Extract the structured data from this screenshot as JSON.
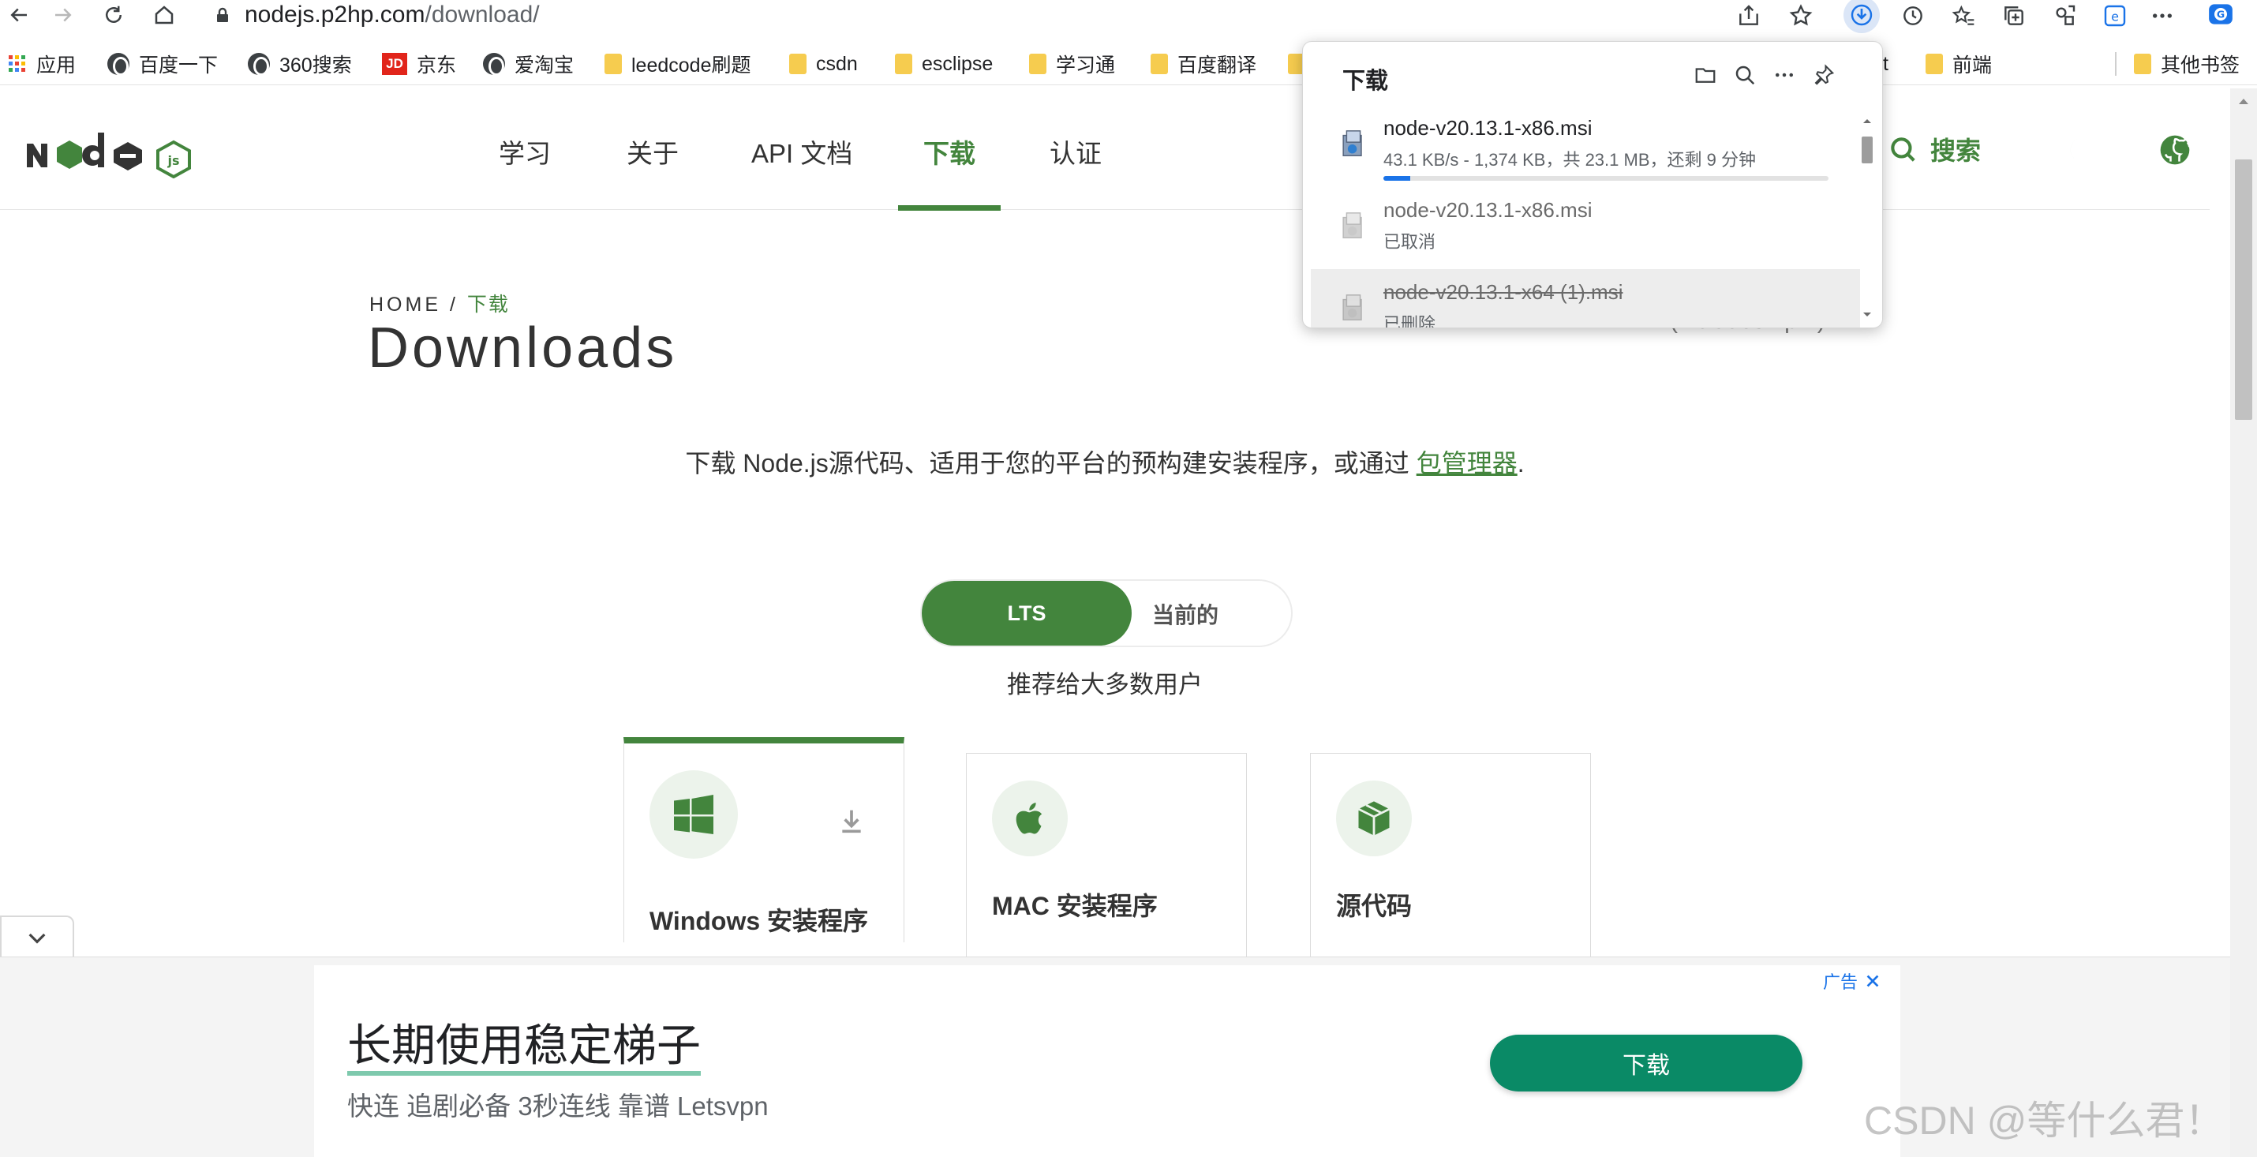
{
  "browser": {
    "url_host": "nodejs.p2hp.com",
    "url_path": "/download/",
    "bookmarks": [
      "应用",
      "百度一下",
      "360搜索",
      "京东",
      "爱淘宝",
      "leedcode刷题",
      "csdn",
      "esclipse",
      "学习通",
      "百度翻译",
      "t",
      "前端",
      "其他书签"
    ]
  },
  "site": {
    "menu": [
      "学习",
      "关于",
      "API 文档",
      "下载",
      "认证"
    ],
    "search_label": "搜索"
  },
  "page": {
    "breadcrumb_home": "HOME",
    "breadcrumb_sep": "/",
    "breadcrumb_current": "下载",
    "title": "Downloads",
    "intro_text": "下载 Node.js源代码、适用于您的平台的预构建安装程序，或通过 ",
    "intro_link": "包管理器",
    "intro_end": ".",
    "right_hint": "(includes npm)",
    "toggle_lts": "LTS",
    "toggle_current": "当前的",
    "recommend": "推荐给大多数用户",
    "cards": [
      "Windows 安装程序",
      "MAC 安装程序",
      "源代码"
    ]
  },
  "downloads_panel": {
    "title": "下载",
    "items": [
      {
        "name": "node-v20.13.1-x86.msi",
        "status": "43.1 KB/s - 1,374 KB，共 23.1 MB，还剩 9 分钟",
        "progress_pct": 6
      },
      {
        "name": "node-v20.13.1-x86.msi",
        "status": "已取消"
      },
      {
        "name": "node-v20.13.1-x64 (1).msi",
        "status": "已删除"
      }
    ]
  },
  "ad": {
    "headline": "长期使用稳定梯子",
    "sub": "快连 追剧必备 3秒连线 靠谱 Letsvpn",
    "cta": "下载",
    "tag": "广告"
  },
  "watermark": "CSDN @等什么君！",
  "colors": {
    "node_green": "#43853d",
    "download_blue": "#1a73e8",
    "ad_button": "#0a8a66"
  }
}
